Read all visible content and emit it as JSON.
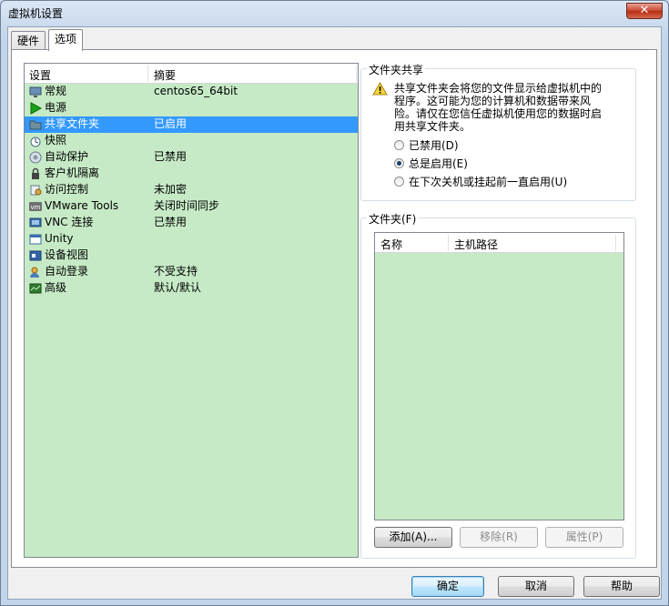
{
  "window": {
    "title": "虚拟机设置",
    "close": "✕"
  },
  "tabs": [
    {
      "label": "硬件"
    },
    {
      "label": "选项"
    }
  ],
  "settings": {
    "headers": {
      "setting": "设置",
      "summary": "摘要"
    },
    "items": [
      {
        "name": "常规",
        "summary": "centos65_64bit",
        "icon": "monitor-icon"
      },
      {
        "name": "电源",
        "summary": "",
        "icon": "power-play-icon"
      },
      {
        "name": "共享文件夹",
        "summary": "已启用",
        "icon": "shared-folder-icon"
      },
      {
        "name": "快照",
        "summary": "",
        "icon": "snapshot-icon"
      },
      {
        "name": "自动保护",
        "summary": "已禁用",
        "icon": "autoprotect-icon"
      },
      {
        "name": "客户机隔离",
        "summary": "",
        "icon": "lock-icon"
      },
      {
        "name": "访问控制",
        "summary": "未加密",
        "icon": "access-control-icon"
      },
      {
        "name": "VMware Tools",
        "summary": "关闭时间同步",
        "icon": "vmware-tools-icon"
      },
      {
        "name": "VNC 连接",
        "summary": "已禁用",
        "icon": "vnc-icon"
      },
      {
        "name": "Unity",
        "summary": "",
        "icon": "unity-icon"
      },
      {
        "name": "设备视图",
        "summary": "",
        "icon": "device-view-icon"
      },
      {
        "name": "自动登录",
        "summary": "不受支持",
        "icon": "autologin-icon"
      },
      {
        "name": "高级",
        "summary": "默认/默认",
        "icon": "advanced-icon"
      }
    ],
    "selected_index": 2
  },
  "sharing": {
    "title": "文件夹共享",
    "warning": "共享文件夹会将您的文件显示给虚拟机中的程序。这可能为您的计算机和数据带来风险。请仅在您信任虚拟机使用您的数据时启用共享文件夹。",
    "options": [
      {
        "label": "已禁用(D)",
        "checked": false
      },
      {
        "label": "总是启用(E)",
        "checked": true
      },
      {
        "label": "在下次关机或挂起前一直启用(U)",
        "checked": false
      }
    ]
  },
  "folders": {
    "title": "文件夹(F)",
    "headers": {
      "name": "名称",
      "path": "主机路径"
    },
    "add": "添加(A)...",
    "remove": "移除(R)",
    "properties": "属性(P)"
  },
  "footer": {
    "ok": "确定",
    "cancel": "取消",
    "help": "帮助"
  },
  "colors": {
    "list_bg": "#c6eac6",
    "selection": "#3399ff"
  }
}
